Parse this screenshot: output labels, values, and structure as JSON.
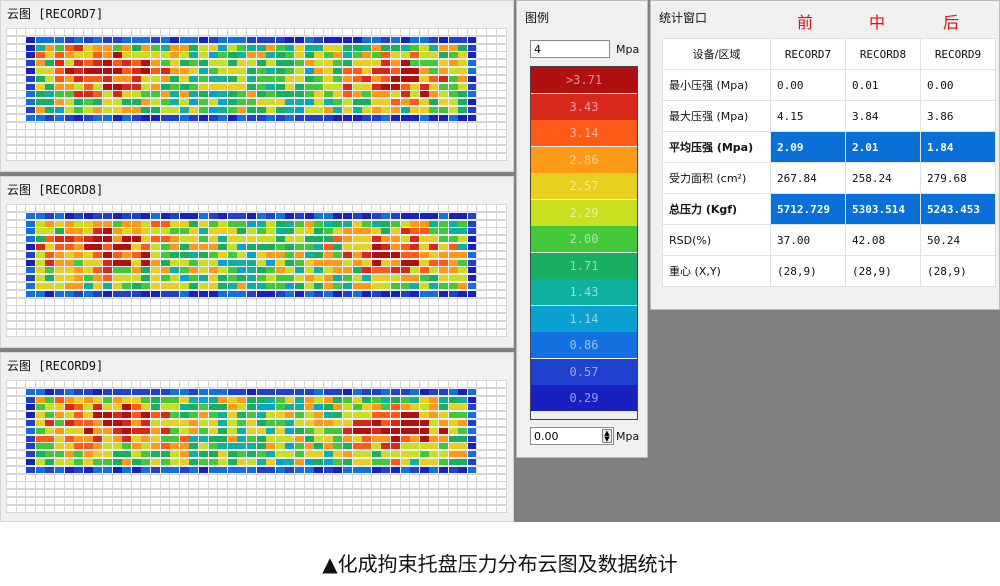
{
  "panels": [
    {
      "title": "云图 [RECORD7]"
    },
    {
      "title": "云图 [RECORD8]"
    },
    {
      "title": "云图 [RECORD9]"
    }
  ],
  "legend": {
    "title": "图例",
    "max_value": "4",
    "min_value": "0.00",
    "unit": "Mpa",
    "bands": [
      ">3.71",
      "3.43",
      "3.14",
      "2.86",
      "2.57",
      "2.29",
      "2.00",
      "1.71",
      "1.43",
      "1.14",
      "0.86",
      "0.57",
      "0.29"
    ],
    "band_colors": [
      "#b01010",
      "#d8281c",
      "#ff5a18",
      "#ff9a18",
      "#e8d020",
      "#c8e020",
      "#42c83a",
      "#18b060",
      "#10b0a0",
      "#0aa0d0",
      "#1470e0",
      "#2040d0",
      "#1820c0"
    ]
  },
  "stats": {
    "title": "统计窗口",
    "tags": [
      "前",
      "中",
      "后"
    ],
    "header": [
      "设备/区域",
      "RECORD7",
      "RECORD8",
      "RECORD9"
    ],
    "rows": [
      {
        "label": "最小压强 (Mpa)",
        "values": [
          "0.00",
          "0.01",
          "0.00"
        ],
        "selected": false
      },
      {
        "label": "最大压强 (Mpa)",
        "values": [
          "4.15",
          "3.84",
          "3.86"
        ],
        "selected": false
      },
      {
        "label": "平均压强 (Mpa)",
        "values": [
          "2.09",
          "2.01",
          "1.84"
        ],
        "selected": true
      },
      {
        "label": "受力面积 (cm²)",
        "values": [
          "267.84",
          "258.24",
          "279.68"
        ],
        "selected": false
      },
      {
        "label": "总压力 (Kgf)",
        "values": [
          "5712.729",
          "5303.514",
          "5243.453"
        ],
        "selected": true
      },
      {
        "label": "RSD(%)",
        "values": [
          "37.00",
          "42.08",
          "50.24"
        ],
        "selected": false
      },
      {
        "label": "重心 (X,Y)",
        "values": [
          "(28,9)",
          "(28,9)",
          "(28,9)"
        ],
        "selected": false
      }
    ]
  },
  "caption": "▲化成拘束托盘压力分布云图及数据统计"
}
